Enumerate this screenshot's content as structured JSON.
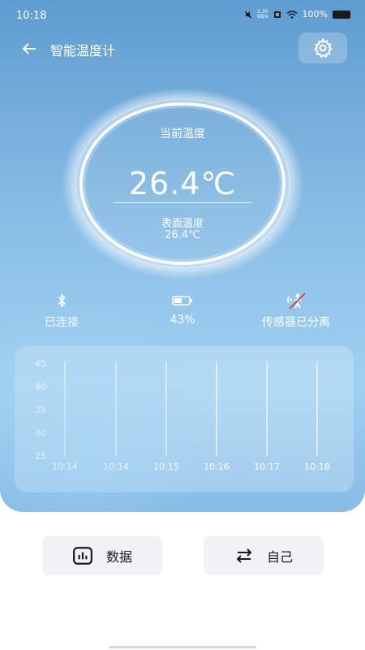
{
  "status_bar": {
    "time": "10:18",
    "net_speed_value": "2.30",
    "net_speed_unit": "KB/s",
    "battery_text": "100%"
  },
  "header": {
    "title": "智能温度计"
  },
  "gauge": {
    "label": "当前温度",
    "value": "26.4℃",
    "sub_label": "表面温度",
    "sub_value": "26.4℃"
  },
  "status_row": {
    "bluetooth_text": "已连接",
    "battery_text": "43%",
    "sensor_text": "传感器已分离"
  },
  "chart_data": {
    "type": "line",
    "categories": [
      "10:14",
      "10:14",
      "10:15",
      "10:16",
      "10:17",
      "10:18"
    ],
    "y_ticks": [
      "45",
      "40",
      "35",
      "30",
      "25"
    ],
    "ylim": [
      25,
      45
    ],
    "series": [],
    "grid": "vertical"
  },
  "buttons": {
    "data_label": "数据",
    "self_label": "自己"
  },
  "colors": {
    "hero_top": "#5e9cd0",
    "hero_bottom": "#9ed0f2",
    "button_bg": "#f1f2f5",
    "text_dark": "#1a1a1a"
  },
  "icons": {
    "back": "arrow-left-icon",
    "settings": "gear-icon",
    "bluetooth": "bluetooth-icon",
    "battery": "battery-icon",
    "sensor": "sensor-detached-icon",
    "data": "bar-chart-icon",
    "self": "swap-arrows-icon"
  }
}
